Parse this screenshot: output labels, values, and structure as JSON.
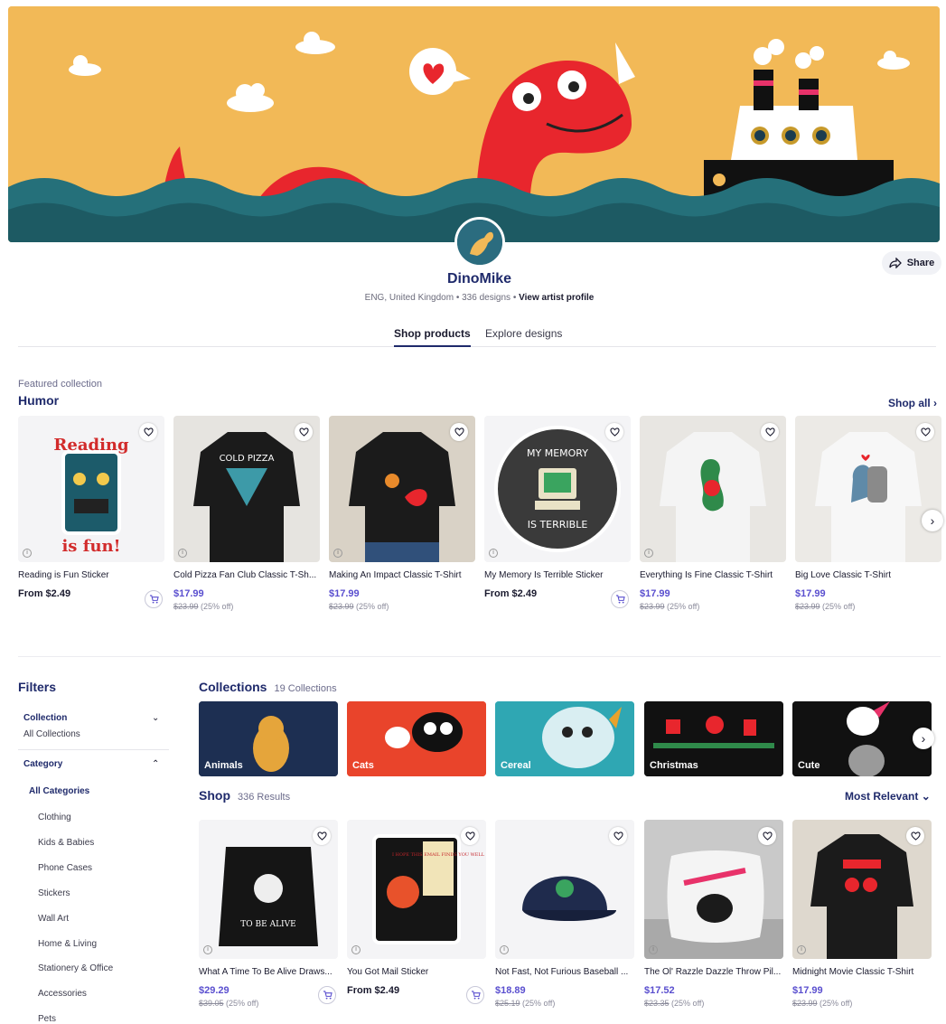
{
  "artist": {
    "name": "DinoMike",
    "location": "ENG, United Kingdom",
    "designs": "336 designs",
    "separator": "•",
    "profile_link": "View artist profile"
  },
  "share_label": "Share",
  "tabs": [
    {
      "label": "Shop products",
      "active": true
    },
    {
      "label": "Explore designs",
      "active": false
    }
  ],
  "featured": {
    "label": "Featured collection",
    "title": "Humor",
    "shop_all": "Shop all",
    "products": [
      {
        "name": "Reading is Fun Sticker",
        "price": "From $2.49",
        "old_price": "",
        "discount": ""
      },
      {
        "name": "Cold Pizza Fan Club Classic T-Sh...",
        "price": "$17.99",
        "old_price": "$23.99",
        "discount": "(25% off)"
      },
      {
        "name": "Making An Impact Classic T-Shirt",
        "price": "$17.99",
        "old_price": "$23.99",
        "discount": "(25% off)"
      },
      {
        "name": "My Memory Is Terrible Sticker",
        "price": "From $2.49",
        "old_price": "",
        "discount": ""
      },
      {
        "name": "Everything Is Fine Classic T-Shirt",
        "price": "$17.99",
        "old_price": "$23.99",
        "discount": "(25% off)"
      },
      {
        "name": "Big Love Classic T-Shirt",
        "price": "$17.99",
        "old_price": "$23.99",
        "discount": "(25% off)"
      }
    ]
  },
  "filters": {
    "title": "Filters",
    "collection_label": "Collection",
    "collection_value": "All Collections",
    "category_label": "Category",
    "category_all": "All Categories",
    "categories": [
      "Clothing",
      "Kids & Babies",
      "Phone Cases",
      "Stickers",
      "Wall Art",
      "Home & Living",
      "Stationery & Office",
      "Accessories",
      "Pets"
    ]
  },
  "collections": {
    "title": "Collections",
    "count": "19 Collections",
    "items": [
      "Animals",
      "Cats",
      "Cereal",
      "Christmas",
      "Cute"
    ]
  },
  "shop": {
    "title": "Shop",
    "count": "336 Results",
    "sort": "Most Relevant",
    "products": [
      {
        "name": "What A Time To Be Alive Draws...",
        "price": "$29.29",
        "old_price": "$39.05",
        "discount": "(25% off)"
      },
      {
        "name": "You Got Mail Sticker",
        "price": "From $2.49",
        "old_price": "",
        "discount": ""
      },
      {
        "name": "Not Fast, Not Furious Baseball ...",
        "price": "$18.89",
        "old_price": "$25.19",
        "discount": "(25% off)"
      },
      {
        "name": "The Ol' Razzle Dazzle Throw Pil...",
        "price": "$17.52",
        "old_price": "$23.35",
        "discount": "(25% off)"
      },
      {
        "name": "Midnight Movie Classic T-Shirt",
        "price": "$17.99",
        "old_price": "$23.99",
        "discount": "(25% off)"
      }
    ]
  },
  "artwork_text": {
    "reading_top": "Reading",
    "reading_bottom": "is fun!",
    "cold_pizza": "COLD PIZZA",
    "memory_top": "MY MEMORY",
    "memory_bottom": "IS TERRIBLE",
    "time_to_be_alive": "TO BE ALIVE",
    "hope_email": "I HOPE THIS EMAIL FINDS YOU WELL"
  },
  "colors": {
    "accent_price": "#5a4fcf",
    "brand_navy": "#1f2a6b",
    "banner_bg": "#f2b957",
    "dino_red": "#e8262d"
  }
}
